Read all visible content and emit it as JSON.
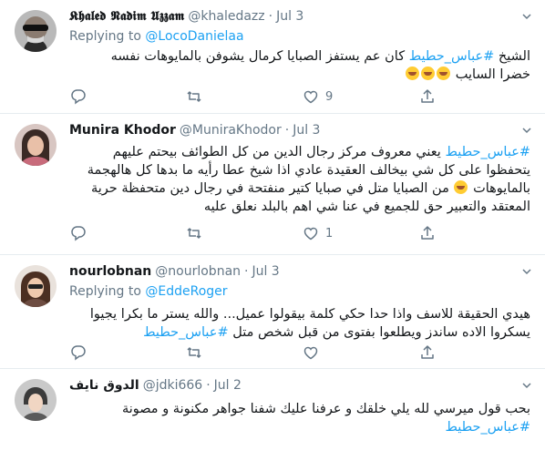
{
  "tweets": [
    {
      "name": "𝕶𝖍𝖆𝖑𝖊𝖉 𝕹𝖆𝖉𝖎𝖒 𝖀𝖟𝖟𝖆𝖒",
      "handle": "@khaledazz",
      "dot": "·",
      "time": "Jul 3",
      "reply_prefix": "Replying to",
      "reply_to": "@LocoDanielaa",
      "line1_pre": "الشيخ ",
      "line1_tag": "#عباس_حطيط",
      "line1_post": " كان عم يستفز  الصبايا كرمال يشوفن بالمايوهات نفسه",
      "line2": "خضرا السايب",
      "replies": "",
      "retweets": "",
      "likes": "9"
    },
    {
      "name": "Munira Khodor",
      "handle": "@MuniraKhodor",
      "dot": "·",
      "time": "Jul 3",
      "line1_tag": "#عباس_حطيط",
      "line1_post": " يعني معروف مركز رجال الدين من كل الطوائف بيحتم عليهم",
      "line2": "يتحفظوا على كل شي بيخالف العقيدة عادي اذا شيخ عطا رأيه ما بدها كل هالهجمة",
      "line3": "بالمايوهات",
      "line3_post": " من الصبايا متل في صبايا كتير منفتحة في رجال دين متحفظة حرية",
      "line4": "المعتقد والتعبير حق للجميع في عنا شي اهم بالبلد نعلق عليه",
      "replies": "",
      "retweets": "",
      "likes": "1"
    },
    {
      "name": "nourlobnan",
      "handle": "@nourlobnan",
      "dot": "·",
      "time": "Jul 3",
      "reply_prefix": "Replying to",
      "reply_to": "@EddeRoger",
      "line1": "هيدي الحقيقة للاسف واذا حدا حكي كلمة بيقولوا عميل... والله يستر ما بكرا يجيوا",
      "line2": "يسكروا الاده ساندز ويطلعوا بفتوى من قبل شخص متل ",
      "line2_tag": "#عباس_حطيط",
      "replies": "",
      "retweets": "",
      "likes": ""
    },
    {
      "name": "الدوق نايف",
      "handle": "@jdki666",
      "dot": "·",
      "time": "Jul 2",
      "line1": "بحب قول ميرسي لله يلي خلقك و عرفنا عليك شفنا جواهر مكنونة و مصونة",
      "line2_tag": "#عباس_حطيط",
      "replies": "",
      "retweets": "",
      "likes": ""
    }
  ],
  "colors": {
    "accent": "#1da1f2",
    "muted": "#657786",
    "text": "#14171a",
    "border": "#e6ecf0"
  },
  "icons": [
    "reply-icon",
    "retweet-icon",
    "like-icon",
    "share-icon",
    "chevron-down-icon",
    "laughing-emoji",
    "hugging-emoji"
  ]
}
